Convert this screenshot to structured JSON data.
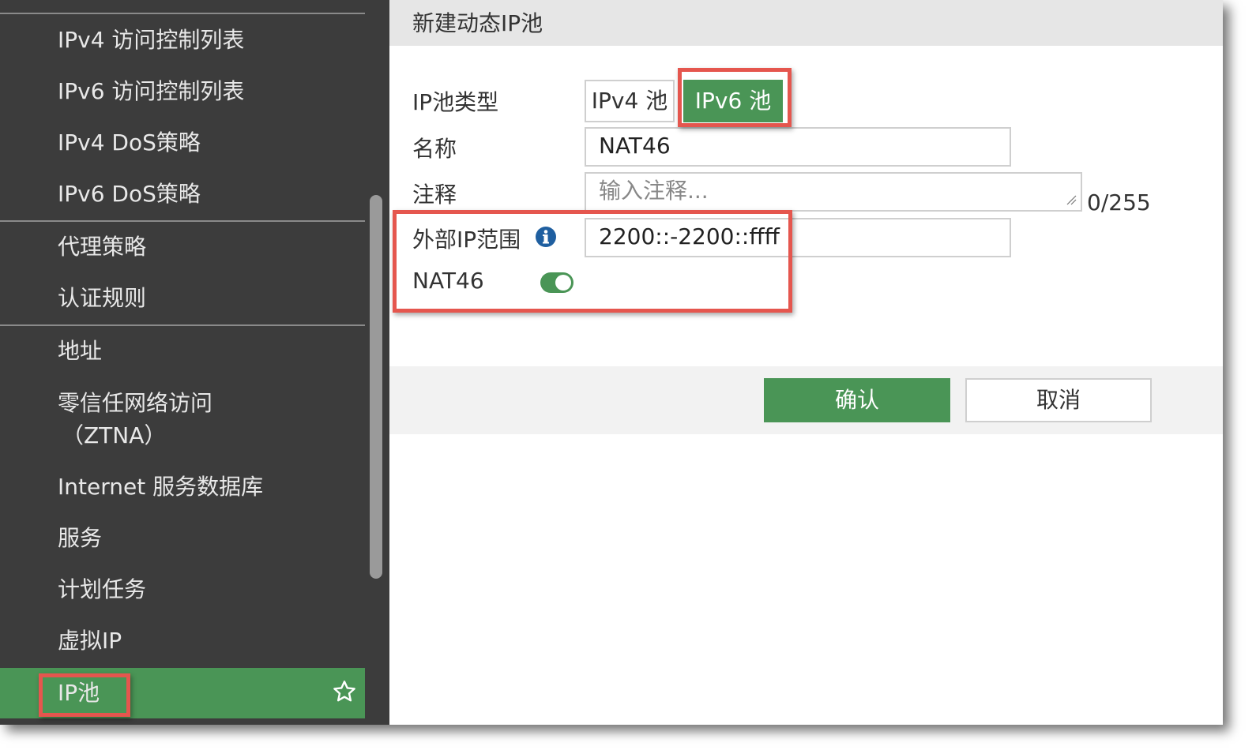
{
  "sidebar": {
    "items": [
      {
        "label": "IPv4 访问控制列表"
      },
      {
        "label": "IPv6 访问控制列表"
      },
      {
        "label": "IPv4 DoS策略"
      },
      {
        "label": "IPv6 DoS策略"
      },
      {
        "label": "代理策略"
      },
      {
        "label": "认证规则"
      },
      {
        "label": "地址"
      },
      {
        "label": "零信任网络访问"
      },
      {
        "label": "（ZTNA）"
      },
      {
        "label": "Internet 服务数据库"
      },
      {
        "label": "服务"
      },
      {
        "label": "计划任务"
      },
      {
        "label": "虚拟IP"
      },
      {
        "label": "IP池"
      }
    ],
    "active_item": "IP池",
    "favorite_icon": "star-icon"
  },
  "dialog": {
    "title": "新建动态IP池",
    "pool_type": {
      "label": "IP池类型",
      "options": [
        "IPv4 池",
        "IPv6 池"
      ],
      "selected": "IPv6 池"
    },
    "name": {
      "label": "名称",
      "value": "NAT46"
    },
    "comment": {
      "label": "注释",
      "placeholder": "输入注释...",
      "counter": "0/255"
    },
    "external_ip_range": {
      "label": "外部IP范围",
      "value": "2200::-2200::ffff",
      "icon": "info-icon"
    },
    "nat46": {
      "label": "NAT46",
      "enabled": true
    },
    "buttons": {
      "ok": "确认",
      "cancel": "取消"
    }
  },
  "colors": {
    "accent_green": "#4a9556",
    "sidebar_bg": "#3c3c3c",
    "highlight_red": "#e5564e",
    "info_blue": "#1f5fa0"
  }
}
